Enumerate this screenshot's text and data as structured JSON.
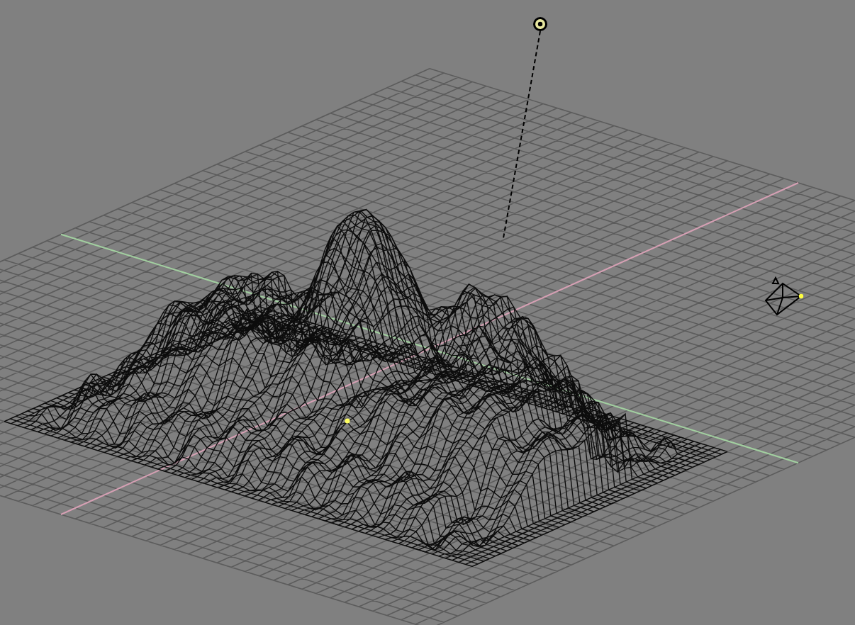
{
  "viewport": {
    "wireframe": true
  }
}
